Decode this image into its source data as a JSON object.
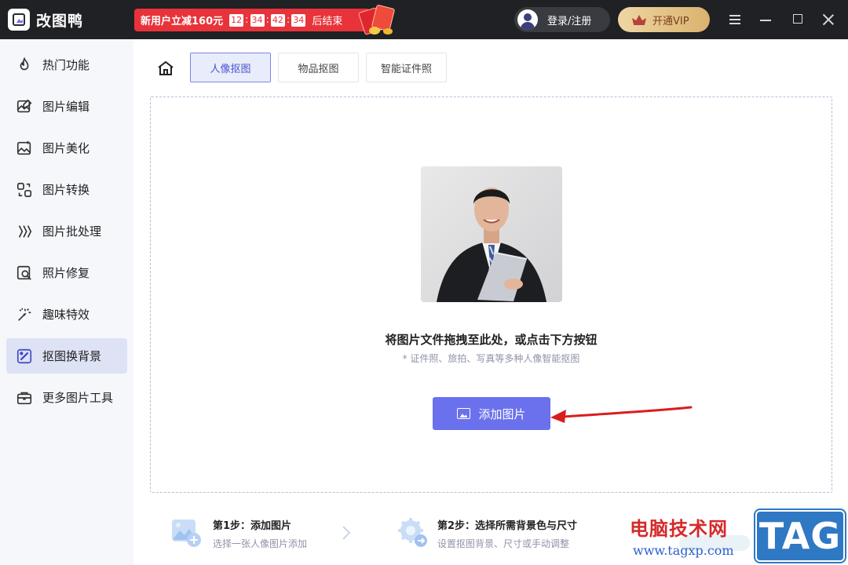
{
  "app": {
    "title": "改图鸭"
  },
  "promo": {
    "text": "新用户立减160元",
    "countdown": [
      "12",
      "34",
      "42",
      "34"
    ],
    "suffix": "后结束"
  },
  "header": {
    "login_label": "登录/注册",
    "vip_label": "开通VIP"
  },
  "sidebar": {
    "items": [
      {
        "label": "热门功能",
        "icon": "flame-icon"
      },
      {
        "label": "图片编辑",
        "icon": "image-edit-icon"
      },
      {
        "label": "图片美化",
        "icon": "image-beautify-icon"
      },
      {
        "label": "图片转换",
        "icon": "image-convert-icon"
      },
      {
        "label": "图片批处理",
        "icon": "batch-icon"
      },
      {
        "label": "照片修复",
        "icon": "photo-repair-icon"
      },
      {
        "label": "趣味特效",
        "icon": "magic-wand-icon"
      },
      {
        "label": "抠图换背景",
        "icon": "cutout-icon",
        "active": true
      },
      {
        "label": "更多图片工具",
        "icon": "toolbox-icon"
      }
    ]
  },
  "tabs": [
    {
      "label": "人像抠图",
      "active": true
    },
    {
      "label": "物品抠图"
    },
    {
      "label": "智能证件照"
    }
  ],
  "dropzone": {
    "title": "将图片文件拖拽至此处，或点击下方按钮",
    "subtitle": "* 证件照、旅拍、写真等多种人像智能抠图",
    "add_button": "添加图片"
  },
  "steps": [
    {
      "title": "第1步：添加图片",
      "desc": "选择一张人像图片添加"
    },
    {
      "title": "第2步：选择所需背景色与尺寸",
      "desc": "设置抠图背景、尺寸或手动调整"
    }
  ],
  "watermark": {
    "site_name": "电脑技术网",
    "url": "www.tagxp.com",
    "tag": "TAG"
  },
  "colors": {
    "titlebar": "#202125",
    "promo_red": "#e8333a",
    "accent": "#6b71ec",
    "active_tab_bg": "#e8ecfb",
    "sidebar_active": "#dde2f4",
    "vip_gold": "#e6c486"
  }
}
